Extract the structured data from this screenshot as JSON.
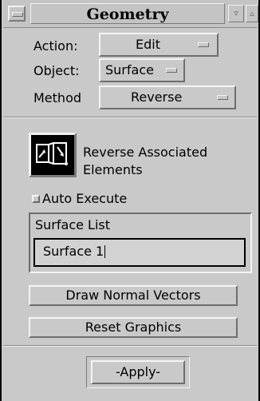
{
  "window": {
    "title": "Geometry"
  },
  "form": {
    "action": {
      "label": "Action:",
      "value": "Edit"
    },
    "object": {
      "label": "Object:",
      "value": "Surface"
    },
    "method": {
      "label": "Method",
      "value": "Reverse"
    }
  },
  "operation": {
    "icon": "reverse-elements-icon",
    "description_line1": "Reverse Associated",
    "description_line2": "Elements"
  },
  "auto_execute": {
    "label": "Auto Execute",
    "checked": false
  },
  "surface_list": {
    "label": "Surface List",
    "value": "Surface 1"
  },
  "buttons": {
    "draw_normals": "Draw Normal Vectors",
    "reset_graphics": "Reset Graphics",
    "apply": "-Apply-"
  },
  "colors": {
    "panel_bg": "#c9c9c9",
    "text": "#000000",
    "field_bg": "#d2d2d2"
  }
}
